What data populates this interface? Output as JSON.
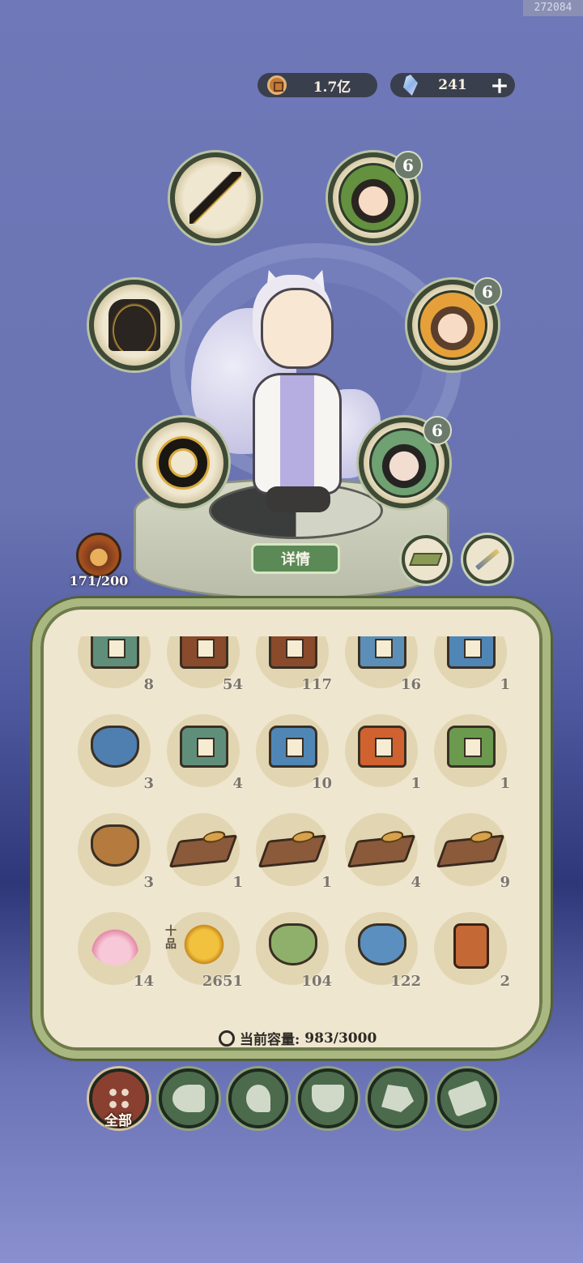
{
  "watermark": "272084",
  "currency": {
    "coins_icon": "copper-coin-icon",
    "coins": "1.7亿",
    "gems_icon": "crystal-gem-icon",
    "gems": "241",
    "add_label": "+"
  },
  "equipment": {
    "weapon_icon": "dagger-icon",
    "robe_icon": "black-robe-icon",
    "ring_icon": "dark-ring-icon",
    "companions": [
      {
        "icon": "companion-portrait-green",
        "level": "6"
      },
      {
        "icon": "companion-portrait-gold",
        "level": "6"
      },
      {
        "icon": "companion-portrait-teal",
        "level": "6"
      }
    ],
    "extra_slots": [
      "tray-icon",
      "feather-fan-icon"
    ]
  },
  "details_button": "详情",
  "level_display": "171/200",
  "inventory": {
    "rows": [
      [
        {
          "icon": "green-chest",
          "count": "8"
        },
        {
          "icon": "brown-chest",
          "count": "54"
        },
        {
          "icon": "brown-chest",
          "count": "117"
        },
        {
          "icon": "blue-chest-scroll",
          "count": "16"
        },
        {
          "icon": "blue-chest",
          "count": "1"
        }
      ],
      [
        {
          "icon": "blue-backpack",
          "count": "3"
        },
        {
          "icon": "green-chest",
          "count": "4"
        },
        {
          "icon": "blue-chest",
          "count": "10"
        },
        {
          "icon": "orange-chest",
          "count": "1"
        },
        {
          "icon": "green-chest-ornate",
          "count": "1"
        }
      ],
      [
        {
          "icon": "brown-bag",
          "count": "3"
        },
        {
          "icon": "spoon-tray",
          "count": "1"
        },
        {
          "icon": "spoon-tray",
          "count": "1"
        },
        {
          "icon": "spoon-tray",
          "count": "4"
        },
        {
          "icon": "spoon-tray",
          "count": "9"
        }
      ],
      [
        {
          "icon": "lotus",
          "count": "14"
        },
        {
          "icon": "golden-grape",
          "count": "2651"
        },
        {
          "icon": "green-bag",
          "count": "104"
        },
        {
          "icon": "blue-bag",
          "count": "122"
        },
        {
          "icon": "hero-token",
          "count": "2"
        }
      ]
    ],
    "quality_tag": "十品",
    "capacity_label": "当前容量:",
    "capacity_value": "983/3000"
  },
  "tabs": [
    {
      "name": "all",
      "label": "全部",
      "active": true
    },
    {
      "name": "wood",
      "icon": "log-icon"
    },
    {
      "name": "herb",
      "icon": "herb-icon"
    },
    {
      "name": "food",
      "icon": "rice-bowl-icon"
    },
    {
      "name": "ore",
      "icon": "ore-icon"
    },
    {
      "name": "scroll",
      "icon": "scroll-icon"
    }
  ],
  "colors": {
    "panel_bg": "#efe6cf",
    "panel_border": "#a9b780",
    "tab_active": "#8a4030",
    "tab_default": "#4b6b4c",
    "badge": "#6b7a6a"
  }
}
